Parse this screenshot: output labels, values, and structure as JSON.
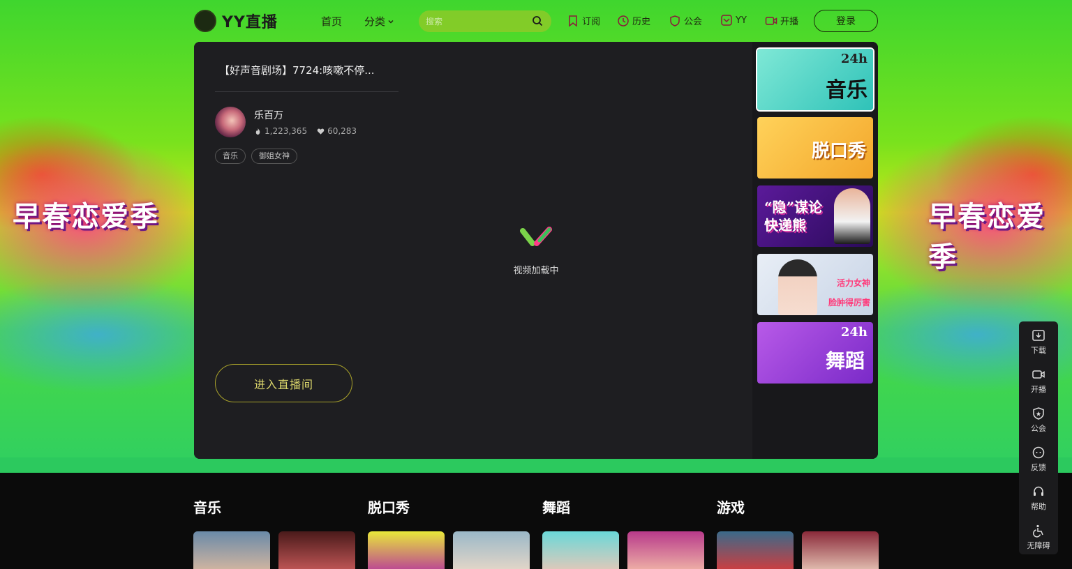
{
  "nav": {
    "logo_text": "YY直播",
    "links": [
      {
        "label": "首页"
      },
      {
        "label": "分类"
      }
    ],
    "search_placeholder": "搜索",
    "tools": [
      {
        "label": "订阅",
        "icon": "bookmark-icon"
      },
      {
        "label": "历史",
        "icon": "clock-icon"
      },
      {
        "label": "公会",
        "icon": "shield-icon"
      },
      {
        "label": "YY",
        "icon": "yy-icon"
      },
      {
        "label": "开播",
        "icon": "camera-icon"
      }
    ],
    "login_label": "登录"
  },
  "hero": {
    "left_text": "早春恋爱季",
    "right_text": "早春恋爱季"
  },
  "player": {
    "room_title": "【好声音剧场】7724:咳嗽不停...",
    "anchor_name": "乐百万",
    "popularity": "1,223,365",
    "likes": "60,283",
    "tags": [
      "音乐",
      "御姐女神"
    ],
    "loading_text": "视频加载中",
    "enter_label": "进入直播间"
  },
  "sidebar": {
    "thumbs": [
      {
        "label": "音乐",
        "badge": "24h"
      },
      {
        "label": "脱口秀",
        "badge": ""
      },
      {
        "label": "“隐”谋论 快递熊",
        "badge": ""
      },
      {
        "label": "活力女神 脸肿得厉害",
        "badge": ""
      },
      {
        "label": "舞蹈",
        "badge": "24h"
      }
    ]
  },
  "float_bar": [
    {
      "label": "下载",
      "icon": "download-icon"
    },
    {
      "label": "开播",
      "icon": "camera-icon"
    },
    {
      "label": "公会",
      "icon": "shield-icon"
    },
    {
      "label": "反馈",
      "icon": "feedback-icon"
    },
    {
      "label": "帮助",
      "icon": "headset-icon"
    },
    {
      "label": "无障碍",
      "icon": "accessibility-icon"
    }
  ],
  "categories": [
    {
      "title": "音乐"
    },
    {
      "title": "脱口秀"
    },
    {
      "title": "舞蹈"
    },
    {
      "title": "游戏"
    }
  ],
  "colors": {
    "accent": "#d8d36a",
    "panel": "#1e1e21"
  }
}
